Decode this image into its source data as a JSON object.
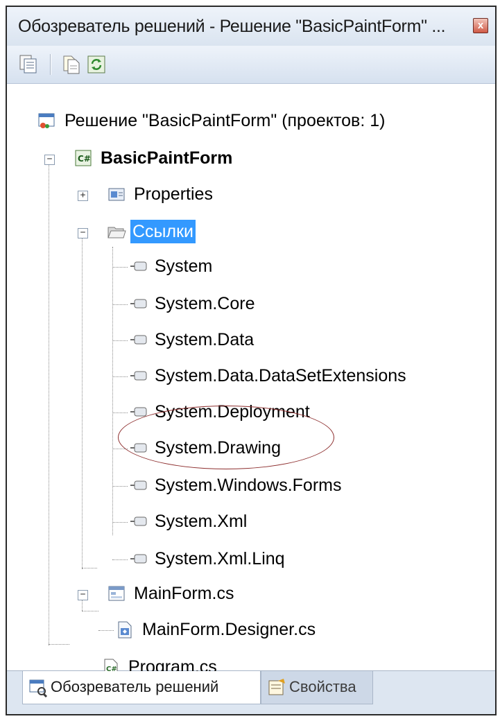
{
  "window": {
    "title": "Обозреватель решений - Решение \"BasicPaintForm\" ...",
    "close_glyph": "x"
  },
  "toolbar": {
    "buttons": [
      {
        "name": "properties-icon"
      },
      {
        "name": "show-all-files-icon"
      },
      {
        "name": "refresh-icon"
      }
    ]
  },
  "tree": {
    "solution": "Решение \"BasicPaintForm\"  (проектов: 1)",
    "project": "BasicPaintForm",
    "properties": "Properties",
    "references": "Ссылки",
    "reference_items": [
      "System",
      "System.Core",
      "System.Data",
      "System.Data.DataSetExtensions",
      "System.Deployment",
      "System.Drawing",
      "System.Windows.Forms",
      "System.Xml",
      "System.Xml.Linq"
    ],
    "mainform": "MainForm.cs",
    "mainform_designer": "MainForm.Designer.cs",
    "program": "Program.cs",
    "expander_collapsed": "+",
    "expander_expanded": "−"
  },
  "tabs": {
    "solution_explorer": "Обозреватель решений",
    "properties": "Свойства"
  },
  "colors": {
    "selection": "#3399ff",
    "annotation_ellipse": "#8c2c2c",
    "panel_background": "#dde6f1"
  }
}
